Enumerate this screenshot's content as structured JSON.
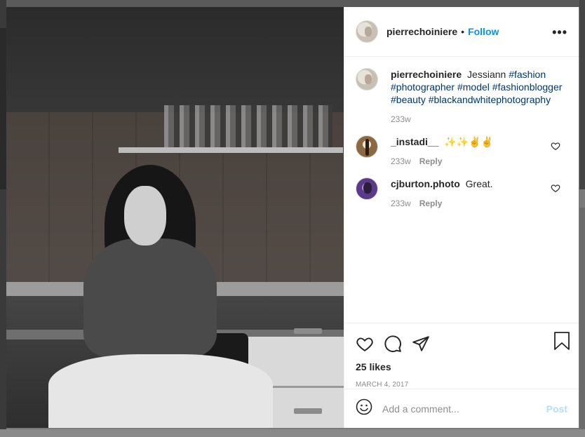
{
  "post": {
    "owner": "pierrechoiniere",
    "follow_label": "Follow",
    "separator": "•",
    "more_label": "•••"
  },
  "caption": {
    "username": "pierrechoiniere",
    "text": "Jessiann",
    "hashtags": [
      "#fashion",
      "#photographer",
      "#model",
      "#fashionblogger",
      "#beauty",
      "#blackandwhitephotography"
    ],
    "time": "233w"
  },
  "comments": [
    {
      "username": "_instadi__",
      "text": "✨✨✌️✌️",
      "time": "233w",
      "reply_label": "Reply"
    },
    {
      "username": "cjburton.photo",
      "text": "Great.",
      "time": "233w",
      "reply_label": "Reply"
    }
  ],
  "actions": {
    "likes": "25 likes",
    "date": "MARCH 4, 2017"
  },
  "composer": {
    "placeholder": "Add a comment...",
    "post_label": "Post"
  },
  "colors": {
    "link": "#0095f6",
    "hashtag": "#00376b",
    "muted": "#8e8e8e",
    "post_disabled": "#b2dffc"
  },
  "icons": {
    "like": "heart-icon",
    "comment": "comment-bubble-icon",
    "share": "paper-plane-icon",
    "save": "bookmark-icon",
    "emoji": "emoji-icon",
    "options": "more-options-icon"
  }
}
